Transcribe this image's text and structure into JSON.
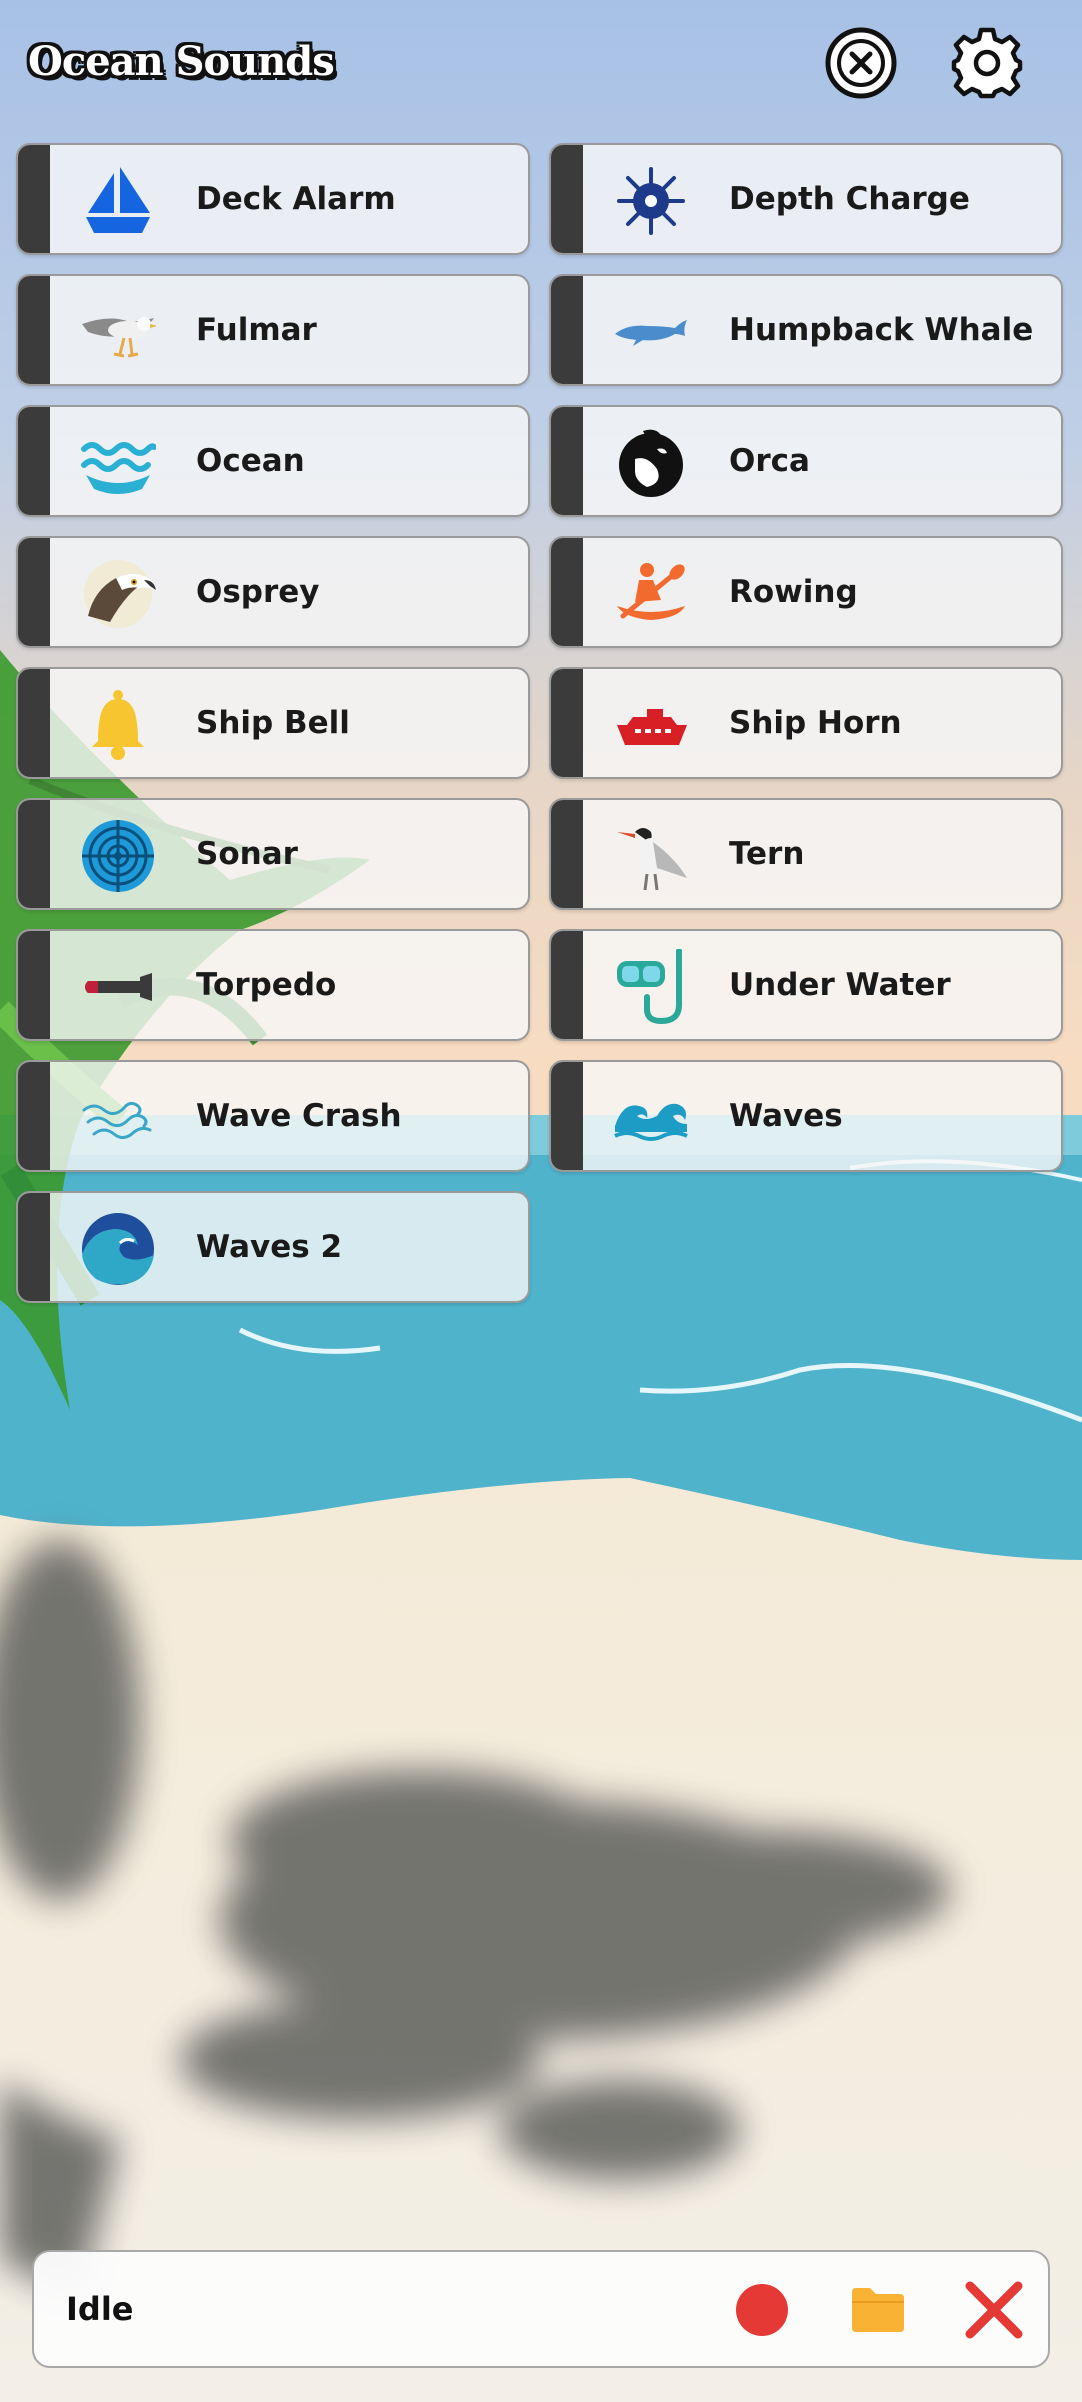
{
  "app": {
    "title": "Ocean Sounds"
  },
  "header": {
    "stop_icon": "stop-all-icon",
    "settings_icon": "gear-icon"
  },
  "sounds": [
    {
      "label": "Deck Alarm",
      "icon": "sailboat-icon"
    },
    {
      "label": "Depth Charge",
      "icon": "sea-mine-icon"
    },
    {
      "label": "Fulmar",
      "icon": "fulmar-bird-icon"
    },
    {
      "label": "Humpback Whale",
      "icon": "whale-icon"
    },
    {
      "label": "Ocean",
      "icon": "water-waves-icon"
    },
    {
      "label": "Orca",
      "icon": "orca-icon"
    },
    {
      "label": "Osprey",
      "icon": "osprey-icon"
    },
    {
      "label": "Rowing",
      "icon": "kayak-icon"
    },
    {
      "label": "Ship Bell",
      "icon": "bell-icon"
    },
    {
      "label": "Ship Horn",
      "icon": "cruise-ship-icon"
    },
    {
      "label": "Sonar",
      "icon": "sonar-icon"
    },
    {
      "label": "Tern",
      "icon": "tern-bird-icon"
    },
    {
      "label": "Torpedo",
      "icon": "torpedo-icon"
    },
    {
      "label": "Under Water",
      "icon": "snorkel-mask-icon"
    },
    {
      "label": "Wave Crash",
      "icon": "wind-waves-icon"
    },
    {
      "label": "Waves",
      "icon": "curling-waves-icon"
    },
    {
      "label": "Waves 2",
      "icon": "big-wave-icon"
    }
  ],
  "status": {
    "text": "Idle",
    "record_icon": "record-icon",
    "folder_icon": "folder-icon",
    "clear_icon": "close-icon"
  },
  "colors": {
    "card_bar": "#3b3b3b",
    "record": "#e53935",
    "folder": "#f9b233",
    "clear": "#e53935",
    "sea": "#4fb3cc",
    "sand": "#f2ede2"
  }
}
